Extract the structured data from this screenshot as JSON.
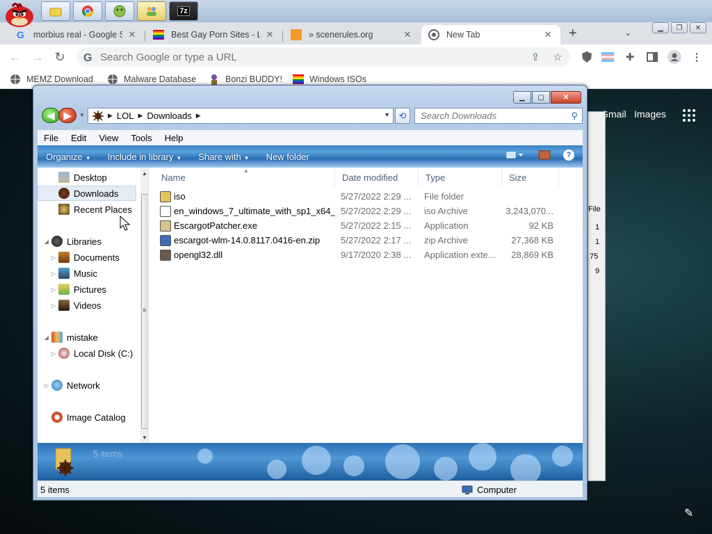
{
  "taskbar": {
    "quicklaunch": [
      {
        "name": "folder-icon"
      },
      {
        "name": "chrome-icon"
      },
      {
        "name": "bonzi-icon"
      },
      {
        "name": "people-icon"
      },
      {
        "name": "sevenzip-icon",
        "label": "7z"
      }
    ]
  },
  "chrome": {
    "tabs": [
      {
        "title": "morbius real - Google S",
        "icon": "google-icon"
      },
      {
        "title": "Best Gay Porn Sites - Li",
        "icon": "rainbow-flag-icon"
      },
      {
        "title": "» scenerules.org",
        "icon": "orange-square-icon"
      },
      {
        "title": "New Tab",
        "icon": "chrome-icon",
        "active": true
      }
    ],
    "new_tab_symbol": "+",
    "omnibox": {
      "placeholder": "Search Google or type a URL"
    },
    "bookmarks": [
      {
        "label": "MEMZ Download"
      },
      {
        "label": "Malware Database"
      },
      {
        "label": "Bonzi BUDDY!"
      },
      {
        "label": "Windows ISOs"
      }
    ]
  },
  "page": {
    "links": [
      "Gmail",
      "Images"
    ]
  },
  "explorer": {
    "breadcrumb": [
      "LOL",
      "Downloads"
    ],
    "search_placeholder": "Search Downloads",
    "menu": [
      "File",
      "Edit",
      "View",
      "Tools",
      "Help"
    ],
    "commands": [
      {
        "label": "Organize",
        "dropdown": true
      },
      {
        "label": "Include in library",
        "dropdown": true
      },
      {
        "label": "Share with",
        "dropdown": true
      },
      {
        "label": "New folder",
        "dropdown": false
      }
    ],
    "nav": {
      "favorites": [
        "Desktop",
        "Downloads",
        "Recent Places"
      ],
      "libraries": {
        "label": "Libraries",
        "items": [
          "Documents",
          "Music",
          "Pictures",
          "Videos"
        ]
      },
      "homegroup": {
        "label": "mistake",
        "items": [
          "Local Disk (C:)"
        ]
      },
      "network": "Network",
      "catalog": "Image Catalog"
    },
    "columns": [
      "Name",
      "Date modified",
      "Type",
      "Size"
    ],
    "files": [
      {
        "name": "iso",
        "date": "5/27/2022 2:29 ...",
        "type": "File folder",
        "size": "",
        "color": "#e6c35c"
      },
      {
        "name": "en_windows_7_ultimate_with_sp1_x64_...",
        "date": "5/27/2022 2:29 ...",
        "type": "iso Archive",
        "size": "3,243,070...",
        "color": "#ffffff"
      },
      {
        "name": "EscargotPatcher.exe",
        "date": "5/27/2022 2:15 ...",
        "type": "Application",
        "size": "92 KB",
        "color": "#d7c28a"
      },
      {
        "name": "escargot-wlm-14.0.8117.0416-en.zip",
        "date": "5/27/2022 2:17 ...",
        "type": "zip Archive",
        "size": "27,368 KB",
        "color": "#3a6fb5"
      },
      {
        "name": "opengl32.dll",
        "date": "9/17/2020 2:38 ...",
        "type": "Application exte...",
        "size": "28,869 KB",
        "color": "#6b5a4a"
      }
    ],
    "details_count": "5 items",
    "status_left": "5 items",
    "status_right": "Computer"
  },
  "behind_window": {
    "header": "File",
    "rows": [
      "1",
      "1",
      "75",
      "9"
    ]
  },
  "colors": {
    "accent": "#3b82c4",
    "tab_bg": "#dee1e6"
  }
}
